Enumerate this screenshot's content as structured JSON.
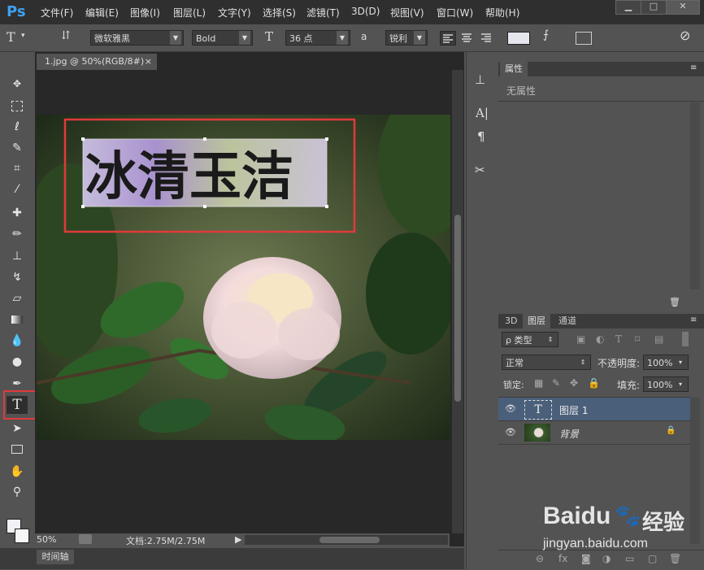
{
  "app": {
    "logo": "Ps"
  },
  "menu": [
    "文件(F)",
    "编辑(E)",
    "图像(I)",
    "图层(L)",
    "文字(Y)",
    "选择(S)",
    "滤镜(T)",
    "3D(D)",
    "视图(V)",
    "窗口(W)",
    "帮助(H)"
  ],
  "window_controls": [
    "▁",
    "□",
    "✕"
  ],
  "options": {
    "font_family": "微软雅黑",
    "font_style": "Bold",
    "font_size": "36 点",
    "aa_label": "a",
    "aa_mode": "锐利"
  },
  "document": {
    "tab_title": "1.jpg @ 50%(RGB/8#)",
    "text_layer": "冰清玉洁",
    "zoom": "50%",
    "doc_info": "文档:2.75M/2.75M"
  },
  "timeline": {
    "label": "时间轴"
  },
  "properties": {
    "tab": "属性",
    "empty": "无属性"
  },
  "layers_panel": {
    "tabs": [
      "3D",
      "图层",
      "通道"
    ],
    "filter_kind": "ρ 类型",
    "blend_mode": "正常",
    "opacity_label": "不透明度:",
    "opacity_value": "100%",
    "lock_label": "锁定:",
    "fill_label": "填充:",
    "fill_value": "100%",
    "layers": [
      {
        "name": "图层 1",
        "thumb": "T"
      },
      {
        "name": "背景"
      }
    ]
  },
  "watermark": {
    "brand": "Baidu",
    "suffix": "经验",
    "url": "jingyan.baidu.com"
  },
  "colors": {
    "accent": "#3ea0f0",
    "highlight": "#e03a3a",
    "selected_layer": "#4a5f7a"
  }
}
